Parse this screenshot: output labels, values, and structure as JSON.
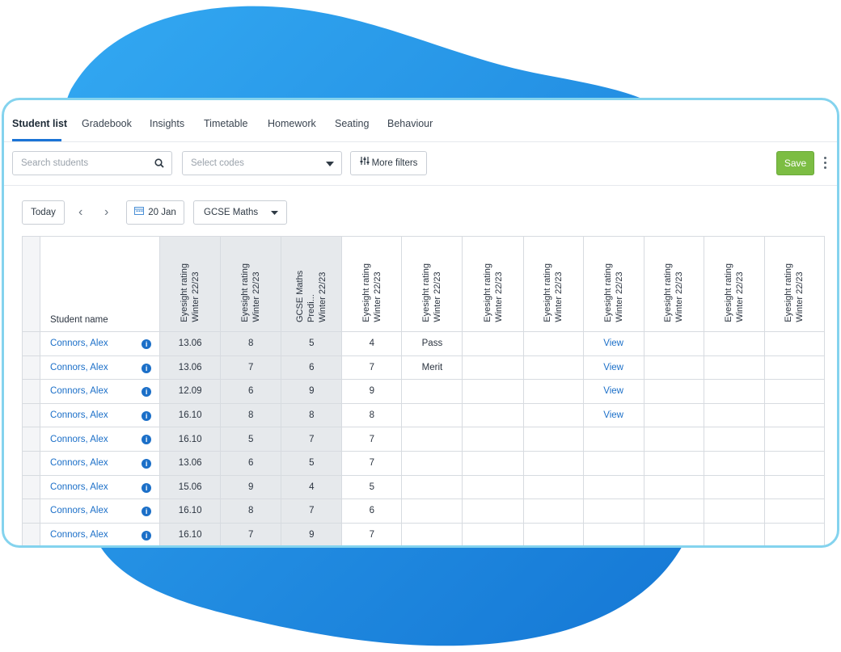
{
  "tabs": [
    "Student list",
    "Gradebook",
    "Insights",
    "Timetable",
    "Homework",
    "Seating",
    "Behaviour"
  ],
  "toolbar": {
    "search_placeholder": "Search students",
    "codes_placeholder": "Select codes",
    "more_filters": "More filters",
    "save": "Save"
  },
  "datebar": {
    "today": "Today",
    "date": "20 Jan",
    "subject": "GCSE Maths"
  },
  "table": {
    "name_header": "Student name",
    "columns": [
      "Eyesight rating\nWinter 22/23",
      "Eyesight rating\nWinter 22/23",
      "GCSE Maths Predi...\nWinter 22/23",
      "Eyesight rating\nWinter 22/23",
      "Eyesight rating\nWinter 22/23",
      "Eyesight rating\nWinter 22/23",
      "Eyesight rating\nWinter 22/23",
      "Eyesight rating\nWinter 22/23",
      "Eyesight rating\nWinter 22/23",
      "Eyesight rating\nWinter 22/23",
      "Eyesight rating\nWinter 22/23"
    ],
    "rows": [
      {
        "name": "Connors, Alex",
        "cells": [
          "13.06",
          "8",
          "5",
          "4",
          "Pass",
          "",
          "",
          "View",
          "",
          "",
          ""
        ]
      },
      {
        "name": "Connors, Alex",
        "cells": [
          "13.06",
          "7",
          "6",
          "7",
          "Merit",
          "",
          "",
          "View",
          "",
          "",
          ""
        ]
      },
      {
        "name": "Connors, Alex",
        "cells": [
          "12.09",
          "6",
          "9",
          "9",
          "",
          "",
          "",
          "View",
          "",
          "",
          ""
        ]
      },
      {
        "name": "Connors, Alex",
        "cells": [
          "16.10",
          "8",
          "8",
          "8",
          "",
          "",
          "",
          "View",
          "",
          "",
          ""
        ]
      },
      {
        "name": "Connors, Alex",
        "cells": [
          "16.10",
          "5",
          "7",
          "7",
          "",
          "",
          "",
          "",
          "",
          "",
          ""
        ]
      },
      {
        "name": "Connors, Alex",
        "cells": [
          "13.06",
          "6",
          "5",
          "7",
          "",
          "",
          "",
          "",
          "",
          "",
          ""
        ]
      },
      {
        "name": "Connors, Alex",
        "cells": [
          "15.06",
          "9",
          "4",
          "5",
          "",
          "",
          "",
          "",
          "",
          "",
          ""
        ]
      },
      {
        "name": "Connors, Alex",
        "cells": [
          "16.10",
          "8",
          "7",
          "6",
          "",
          "",
          "",
          "",
          "",
          "",
          ""
        ]
      },
      {
        "name": "Connors, Alex",
        "cells": [
          "16.10",
          "7",
          "9",
          "7",
          "",
          "",
          "",
          "",
          "",
          "",
          ""
        ]
      }
    ]
  },
  "colors": {
    "accent": "#1b74d6",
    "save": "#7cbd43",
    "card_border": "#84d3ee",
    "blob": "#1f8fe6"
  },
  "icons": {
    "search": "search-icon",
    "caret": "caret-down-icon",
    "filter": "sliders-icon",
    "calendar": "calendar-icon",
    "info": "info-icon",
    "kebab": "more-vertical-icon"
  }
}
